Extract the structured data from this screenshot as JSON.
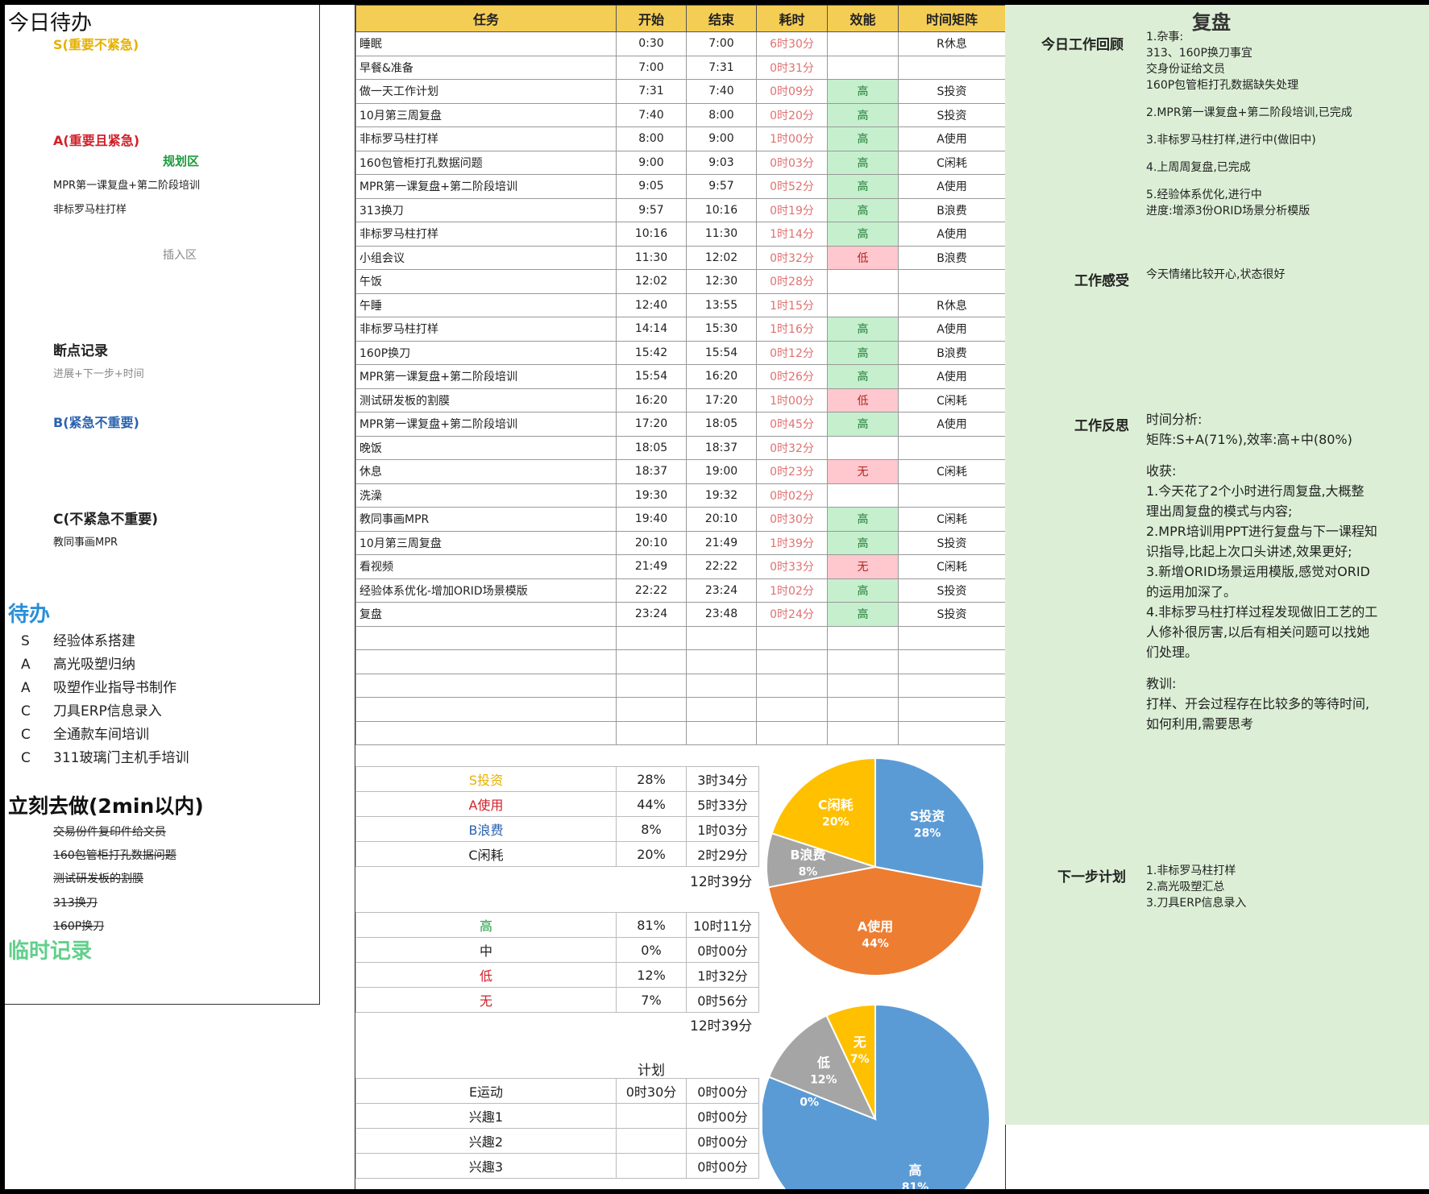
{
  "left": {
    "title": "今日待办",
    "s_label": "S(重要不紧急)",
    "a_label": "A(重要且紧急)",
    "plan_area": "规划区",
    "a_items": [
      "MPR第一课复盘+第二阶段培训",
      "非标罗马柱打样"
    ],
    "insert_area": "插入区",
    "breakpoint_title": "断点记录",
    "breakpoint_hint": "进展+下一步+时间",
    "b_label": "B(紧急不重要)",
    "c_label": "C(不紧急不重要)",
    "c_items": [
      "教同事画MPR"
    ],
    "todo_title": "待办",
    "todo_items": [
      {
        "tag": "S",
        "text": "经验体系搭建"
      },
      {
        "tag": "A",
        "text": "高光吸塑归纳"
      },
      {
        "tag": "A",
        "text": "吸塑作业指导书制作"
      },
      {
        "tag": "C",
        "text": "刀具ERP信息录入"
      },
      {
        "tag": "C",
        "text": "全通款车间培训"
      },
      {
        "tag": "C",
        "text": "311玻璃门主机手培训"
      }
    ],
    "doit_title": "立刻去做(2min以内)",
    "doit_items": [
      "交易份件复印件给文员",
      "160包管柜打孔数据问题",
      "测试研发板的割膜",
      "313换刀",
      "160P换刀"
    ],
    "temp_title": "临时记录"
  },
  "schedule": {
    "headers": [
      "任务",
      "开始",
      "结束",
      "耗时",
      "效能",
      "时间矩阵"
    ],
    "rows": [
      {
        "task": "睡眠",
        "start": "0:30",
        "end": "7:00",
        "dur": "6时30分",
        "eff": "",
        "mat": "R休息"
      },
      {
        "task": "早餐&准备",
        "start": "7:00",
        "end": "7:31",
        "dur": "0时31分",
        "eff": "",
        "mat": ""
      },
      {
        "task": "做一天工作计划",
        "start": "7:31",
        "end": "7:40",
        "dur": "0时09分",
        "eff": "高",
        "mat": "S投资"
      },
      {
        "task": "10月第三周复盘",
        "start": "7:40",
        "end": "8:00",
        "dur": "0时20分",
        "eff": "高",
        "mat": "S投资"
      },
      {
        "task": "非标罗马柱打样",
        "start": "8:00",
        "end": "9:00",
        "dur": "1时00分",
        "eff": "高",
        "mat": "A使用"
      },
      {
        "task": "160包管柜打孔数据问题",
        "start": "9:00",
        "end": "9:03",
        "dur": "0时03分",
        "eff": "高",
        "mat": "C闲耗"
      },
      {
        "task": "MPR第一课复盘+第二阶段培训",
        "start": "9:05",
        "end": "9:57",
        "dur": "0时52分",
        "eff": "高",
        "mat": "A使用"
      },
      {
        "task": "313换刀",
        "start": "9:57",
        "end": "10:16",
        "dur": "0时19分",
        "eff": "高",
        "mat": "B浪费"
      },
      {
        "task": "非标罗马柱打样",
        "start": "10:16",
        "end": "11:30",
        "dur": "1时14分",
        "eff": "高",
        "mat": "A使用"
      },
      {
        "task": "小组会议",
        "start": "11:30",
        "end": "12:02",
        "dur": "0时32分",
        "eff": "低",
        "mat": "B浪费"
      },
      {
        "task": "午饭",
        "start": "12:02",
        "end": "12:30",
        "dur": "0时28分",
        "eff": "",
        "mat": ""
      },
      {
        "task": "午睡",
        "start": "12:40",
        "end": "13:55",
        "dur": "1时15分",
        "eff": "",
        "mat": "R休息"
      },
      {
        "task": "非标罗马柱打样",
        "start": "14:14",
        "end": "15:30",
        "dur": "1时16分",
        "eff": "高",
        "mat": "A使用"
      },
      {
        "task": "160P换刀",
        "start": "15:42",
        "end": "15:54",
        "dur": "0时12分",
        "eff": "高",
        "mat": "B浪费"
      },
      {
        "task": "MPR第一课复盘+第二阶段培训",
        "start": "15:54",
        "end": "16:20",
        "dur": "0时26分",
        "eff": "高",
        "mat": "A使用"
      },
      {
        "task": "测试研发板的割膜",
        "start": "16:20",
        "end": "17:20",
        "dur": "1时00分",
        "eff": "低",
        "mat": "C闲耗"
      },
      {
        "task": "MPR第一课复盘+第二阶段培训",
        "start": "17:20",
        "end": "18:05",
        "dur": "0时45分",
        "eff": "高",
        "mat": "A使用"
      },
      {
        "task": "晚饭",
        "start": "18:05",
        "end": "18:37",
        "dur": "0时32分",
        "eff": "",
        "mat": ""
      },
      {
        "task": "休息",
        "start": "18:37",
        "end": "19:00",
        "dur": "0时23分",
        "eff": "无",
        "mat": "C闲耗"
      },
      {
        "task": "洗澡",
        "start": "19:30",
        "end": "19:32",
        "dur": "0时02分",
        "eff": "",
        "mat": ""
      },
      {
        "task": "教同事画MPR",
        "start": "19:40",
        "end": "20:10",
        "dur": "0时30分",
        "eff": "高",
        "mat": "C闲耗"
      },
      {
        "task": "10月第三周复盘",
        "start": "20:10",
        "end": "21:49",
        "dur": "1时39分",
        "eff": "高",
        "mat": "S投资"
      },
      {
        "task": "看视频",
        "start": "21:49",
        "end": "22:22",
        "dur": "0时33分",
        "eff": "无",
        "mat": "C闲耗"
      },
      {
        "task": "经验体系优化-增加ORID场景模版",
        "start": "22:22",
        "end": "23:24",
        "dur": "1时02分",
        "eff": "高",
        "mat": "S投资"
      },
      {
        "task": "复盘",
        "start": "23:24",
        "end": "23:48",
        "dur": "0时24分",
        "eff": "高",
        "mat": "S投资"
      }
    ]
  },
  "matrix_stats": {
    "rows": [
      {
        "name": "S投资",
        "pct": "28%",
        "time": "3时34分",
        "color": "#e6b000"
      },
      {
        "name": "A使用",
        "pct": "44%",
        "time": "5时33分",
        "color": "#d0202a"
      },
      {
        "name": "B浪费",
        "pct": "8%",
        "time": "1时03分",
        "color": "#2a62b0"
      },
      {
        "name": "C闲耗",
        "pct": "20%",
        "time": "2时29分",
        "color": "#222222"
      }
    ],
    "total": "12时39分"
  },
  "eff_stats": {
    "rows": [
      {
        "name": "高",
        "pct": "81%",
        "time": "10时11分",
        "color": "#1a9a3a"
      },
      {
        "name": "中",
        "pct": "0%",
        "time": "0时00分",
        "color": "#222222"
      },
      {
        "name": "低",
        "pct": "12%",
        "time": "1时32分",
        "color": "#d0202a"
      },
      {
        "name": "无",
        "pct": "7%",
        "time": "0时56分",
        "color": "#d0202a"
      }
    ],
    "total": "12时39分"
  },
  "plan": {
    "title": "计划",
    "rows": [
      {
        "name": "E运动",
        "plan": "0时30分",
        "actual": "0时00分"
      },
      {
        "name": "兴趣1",
        "plan": "",
        "actual": "0时00分"
      },
      {
        "name": "兴趣2",
        "plan": "",
        "actual": "0时00分"
      },
      {
        "name": "兴趣3",
        "plan": "",
        "actual": "0时00分"
      }
    ]
  },
  "chart_data": [
    {
      "type": "pie",
      "categories": [
        "S投资",
        "A使用",
        "B浪费",
        "C闲耗"
      ],
      "values": [
        28,
        44,
        8,
        20
      ],
      "labels": [
        "28%",
        "44%",
        "8%",
        "20%"
      ],
      "colors": [
        "#5b9bd5",
        "#ed7d31",
        "#a5a5a5",
        "#ffc000"
      ]
    },
    {
      "type": "pie",
      "categories": [
        "高",
        "中",
        "低",
        "无"
      ],
      "values": [
        81,
        0,
        12,
        7
      ],
      "labels": [
        "81%",
        "0%",
        "12%",
        "7%"
      ],
      "colors": [
        "#5b9bd5",
        "#ed7d31",
        "#a5a5a5",
        "#ffc000"
      ]
    }
  ],
  "review": {
    "title": "复盘",
    "recap_label": "今日工作回顾",
    "recap_lines": [
      "1.杂事:",
      "313、160P换刀事宜",
      "交身份证给文员",
      "160P包管柜打孔数据缺失处理",
      "",
      "2.MPR第一课复盘+第二阶段培训,已完成",
      "",
      "3.非标罗马柱打样,进行中(做旧中)",
      "",
      "4.上周周复盘,已完成",
      "",
      "5.经验体系优化,进行中",
      "进度:增添3份ORID场景分析模版"
    ],
    "feel_label": "工作感受",
    "feel_text": "今天情绪比较开心,状态很好",
    "reflect_label": "工作反思",
    "reflect_lines": [
      "时间分析:",
      "矩阵:S+A(71%),效率:高+中(80%)",
      "",
      "收获:",
      "1.今天花了2个小时进行周复盘,大概整",
      "理出周复盘的模式与内容;",
      "2.MPR培训用PPT进行复盘与下一课程知",
      "识指导,比起上次口头讲述,效果更好;",
      "3.新增ORID场景运用模版,感觉对ORID",
      "的运用加深了。",
      "4.非标罗马柱打样过程发现做旧工艺的工",
      "人修补很厉害,以后有相关问题可以找她",
      "们处理。",
      "",
      "教训:",
      "打样、开会过程存在比较多的等待时间,",
      "如何利用,需要思考"
    ],
    "next_label": "下一步计划",
    "next_lines": [
      "1.非标罗马柱打样",
      "2.高光吸塑汇总",
      "3.刀具ERP信息录入"
    ]
  }
}
